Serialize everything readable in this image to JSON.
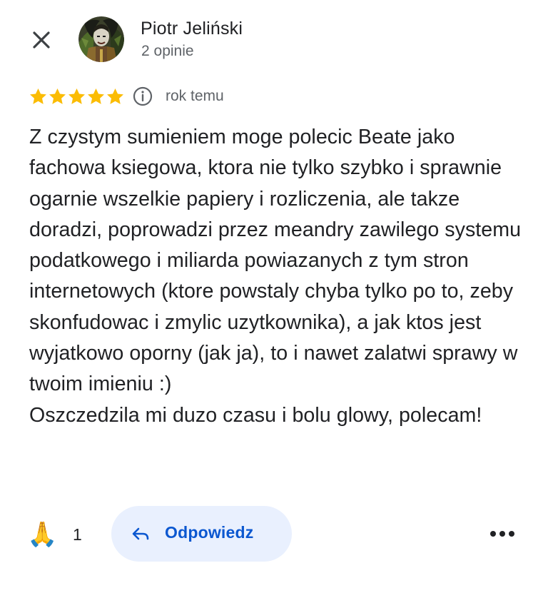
{
  "header": {
    "close_icon": "close-icon",
    "author_name": "Piotr Jeliński",
    "author_meta": "2 opinie"
  },
  "rating": {
    "stars": 5,
    "max_stars": 5,
    "star_color": "#fbbc04",
    "info_icon": "info-icon",
    "time": "rok temu"
  },
  "review": {
    "text": "Z czystym sumieniem moge polecic Beate jako fachowa ksiegowa, ktora nie tylko szybko i sprawnie ogarnie wszelkie papiery i rozliczenia, ale takze doradzi, poprowadzi przez meandry zawilego systemu podatkowego i miliarda powiazanych z tym stron internetowych (ktore powstaly chyba tylko po to, zeby skonfudowac i zmylic uzytkownika), a jak ktos jest wyjatkowo oporny (jak ja), to i nawet zalatwi sprawy w twoim imieniu :)\nOszczedzila mi duzo czasu i bolu glowy, polecam!"
  },
  "actions": {
    "like_icon": "🙏",
    "like_count": "1",
    "reply_icon": "reply-arrow-icon",
    "reply_label": "Odpowiedz",
    "more_icon": "more-horizontal-icon"
  },
  "colors": {
    "accent": "#0b57d0",
    "reply_background": "#e9f0fe",
    "secondary_text": "#5f6368"
  }
}
